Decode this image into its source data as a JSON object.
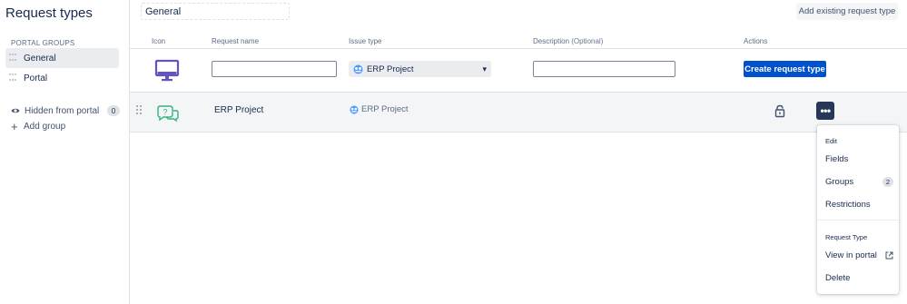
{
  "page": {
    "title": "Request types"
  },
  "sidebar": {
    "section_label": "PORTAL GROUPS",
    "groups": [
      {
        "label": "General",
        "selected": true
      },
      {
        "label": "Portal",
        "selected": false
      }
    ],
    "hidden": {
      "label": "Hidden from portal",
      "count": "0",
      "icon": "eye-icon"
    },
    "add_group": {
      "label": "Add group",
      "icon": "plus-icon"
    }
  },
  "header": {
    "group_name_value": "General",
    "add_existing_label": "Add existing request type"
  },
  "table": {
    "columns": {
      "icon": "Icon",
      "name": "Request name",
      "issue": "Issue type",
      "description": "Description",
      "description_optional": "(Optional)",
      "actions": "Actions"
    },
    "create_row": {
      "icon": "monitor-icon",
      "name_value": "",
      "issue_type_selected": "ERP Project",
      "description_value": "",
      "create_label": "Create request type"
    },
    "rows": [
      {
        "name": "ERP Project",
        "issue_type": "ERP Project",
        "icon": "question-chat-icon"
      }
    ]
  },
  "menu": {
    "sections": [
      {
        "heading": "Edit",
        "items": [
          {
            "label": "Fields"
          },
          {
            "label": "Groups",
            "badge": "2"
          },
          {
            "label": "Restrictions"
          }
        ]
      },
      {
        "heading": "Request Type",
        "items": [
          {
            "label": "View in portal",
            "icon": "external-link-icon"
          },
          {
            "label": "Delete"
          }
        ]
      }
    ]
  },
  "colors": {
    "primary": "#0052cc",
    "dark_button": "#253858",
    "monitor_icon": "#6554c0",
    "question_icon": "#36b37e",
    "row_bg": "#f4f5f7"
  }
}
